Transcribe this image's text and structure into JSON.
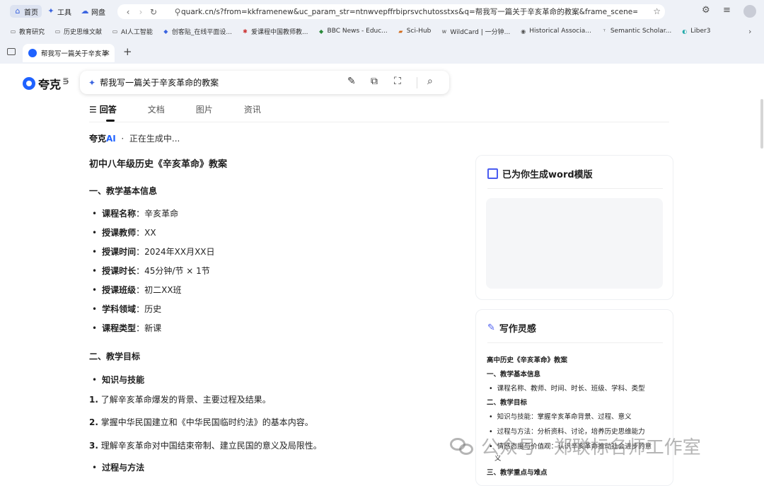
{
  "browser": {
    "nav": [
      {
        "label": "首页",
        "icon": "home-icon"
      },
      {
        "label": "工具",
        "icon": "tools-icon"
      },
      {
        "label": "网盘",
        "icon": "cloud-icon"
      }
    ],
    "url": "quark.cn/s?from=kkframenew&uc_param_str=ntnwvepffrbiprsvchutosstxs&q=帮我写一篇关于辛亥革命的教案&frame_scene=doc...",
    "bookmarks": [
      "教育研究",
      "历史思维文献",
      "AI人工智能",
      "创客贴_在线平面设...",
      "爱课程中国教师教...",
      "BBC News - Educ...",
      "Sci-Hub",
      "WildCard | 一分钟...",
      "Historical Associa...",
      "Semantic Scholar...",
      "Liber3"
    ],
    "tab_title": "帮我写一篇关于辛亥革",
    "colors": {
      "accent": "#1f62ff",
      "chrome_bg": "#eef1f7"
    }
  },
  "app": {
    "logo": "夸克",
    "search_query": "帮我写一篇关于辛亥革命的教案",
    "tabs": [
      "回答",
      "文档",
      "图片",
      "资讯"
    ],
    "ai_brand": "夸克",
    "ai_suffix": "AI",
    "ai_dot": "·",
    "ai_status": "正在生成中..."
  },
  "doc": {
    "title": "初中八年级历史《辛亥革命》教案",
    "section1": "一、教学基本信息",
    "info": [
      {
        "k": "课程名称",
        "v": "：辛亥革命"
      },
      {
        "k": "授课教师",
        "v": "：XX"
      },
      {
        "k": "授课时间",
        "v": "：2024年XX月XX日"
      },
      {
        "k": "授课时长",
        "v": "：45分钟/节 × 1节"
      },
      {
        "k": "授课班级",
        "v": "：初二XX班"
      },
      {
        "k": "学科领域",
        "v": "：历史"
      },
      {
        "k": "课程类型",
        "v": "：新课"
      }
    ],
    "section2": "二、教学目标",
    "sub1": "知识与技能",
    "goals": [
      {
        "n": "1.",
        "t": " 了解辛亥革命爆发的背景、主要过程及结果。"
      },
      {
        "n": "2.",
        "t": " 掌握中华民国建立和《中华民国临时约法》的基本内容。"
      },
      {
        "n": "3.",
        "t": " 理解辛亥革命对中国结束帝制、建立民国的意义及局限性。"
      }
    ],
    "sub2": "过程与方法"
  },
  "side": {
    "card1_title": "已为你生成word模版",
    "card2_title": "写作灵感",
    "inspiration": [
      {
        "type": "b",
        "text": "高中历史《辛亥革命》教案"
      },
      {
        "type": "b",
        "text": "一、教学基本信息"
      },
      {
        "type": "li",
        "text": "课程名称、教师、时间、时长、班级、学科、类型"
      },
      {
        "type": "b",
        "text": "二、教学目标"
      },
      {
        "type": "li",
        "text": "知识与技能：掌握辛亥革命背景、过程、意义"
      },
      {
        "type": "li",
        "text": "过程与方法：分析资料、讨论，培养历史思维能力"
      },
      {
        "type": "li",
        "text": "情感态度与价值观：认识辛亥革命推动社会进步的意"
      },
      {
        "type": "cont",
        "text": "义"
      },
      {
        "type": "b",
        "text": "三、教学重点与难点"
      }
    ]
  },
  "watermark": "公众号 · 郑联标名师工作室"
}
